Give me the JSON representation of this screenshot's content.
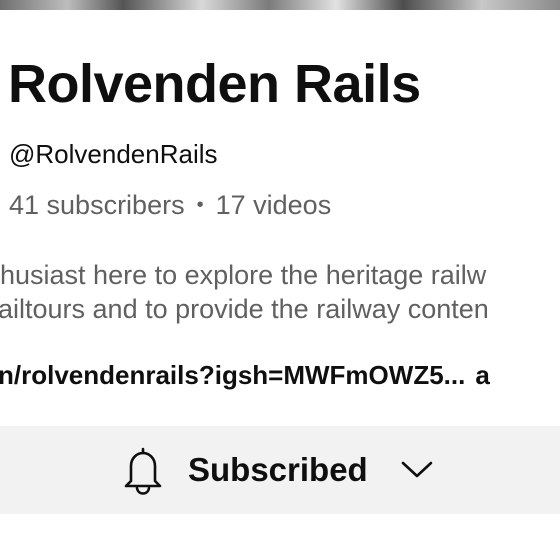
{
  "channel": {
    "name": "Rolvenden Rails",
    "handle": "@RolvendenRails",
    "subscribers": "41 subscribers",
    "separator": "•",
    "videos": "17 videos"
  },
  "description": {
    "line1": "husiast here to explore the heritage railw",
    "line2": "ailtours and to provide the railway conten"
  },
  "link": {
    "text": "n/rolvendenrails?igsh=MWFmOWZ5...",
    "more": "a"
  },
  "subscribe": {
    "label": "Subscribed",
    "bell_icon": "bell-icon",
    "chevron_icon": "chevron-down-icon"
  }
}
